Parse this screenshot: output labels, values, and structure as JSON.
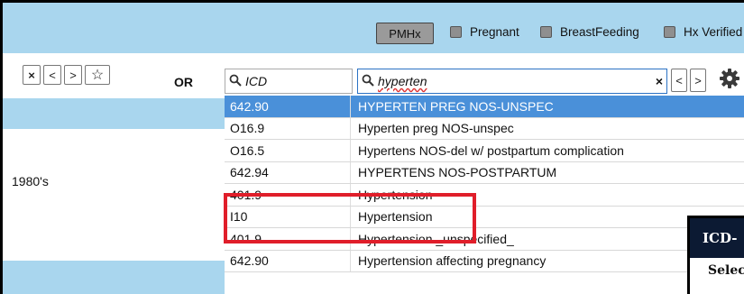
{
  "toolbar": {
    "pmhx_label": "PMHx",
    "checkboxes": [
      {
        "label": "Pregnant",
        "checked": false
      },
      {
        "label": "BreastFeeding",
        "checked": false
      },
      {
        "label": "Hx Verified",
        "checked": false
      }
    ]
  },
  "search": {
    "or_label": "OR",
    "icd_placeholder": "ICD",
    "icd_value": "",
    "term_value": "hyperten",
    "clear_label": "×"
  },
  "nav": {
    "close_label": "×",
    "prev_label": "<",
    "next_label": ">",
    "star_label": "☆"
  },
  "left_panel": {
    "rows": [
      "",
      "",
      "1980's",
      "",
      ""
    ]
  },
  "results": [
    {
      "code": "642.90",
      "description": "HYPERTEN PREG NOS-UNSPEC",
      "selected": true
    },
    {
      "code": "O16.9",
      "description": "Hyperten preg NOS-unspec",
      "selected": false
    },
    {
      "code": "O16.5",
      "description": "Hypertens NOS-del w/ postpartum complication",
      "selected": false
    },
    {
      "code": "642.94",
      "description": "HYPERTENS NOS-POSTPARTUM",
      "selected": false
    },
    {
      "code": "401.9",
      "description": "Hypertension",
      "selected": false
    },
    {
      "code": "I10",
      "description": "Hypertension",
      "selected": false
    },
    {
      "code": "401.9",
      "description": "Hypertension _unspecified_",
      "selected": false
    },
    {
      "code": "642.90",
      "description": "Hypertension affecting pregnancy",
      "selected": false
    }
  ],
  "popup": {
    "header": "ICD-",
    "subtext": "Selec"
  },
  "colors": {
    "header_bg": "#a9d6ee",
    "selected_row": "#4a90d9",
    "highlight_border": "#e01e2a",
    "popup_header": "#0c1a33"
  }
}
